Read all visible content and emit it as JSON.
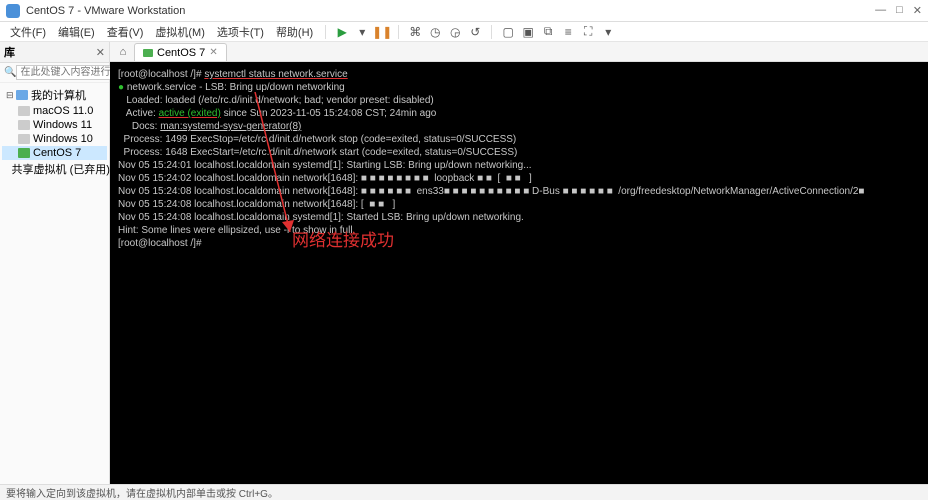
{
  "window": {
    "title": "CentOS 7 - VMware Workstation"
  },
  "menus": [
    "文件(F)",
    "编辑(E)",
    "查看(V)",
    "虚拟机(M)",
    "选项卡(T)",
    "帮助(H)"
  ],
  "sidebar": {
    "title": "库",
    "search_placeholder": "在此处键入内容进行搜索",
    "root": "我的计算机",
    "items": [
      {
        "label": "macOS 11.0",
        "on": false
      },
      {
        "label": "Windows 11",
        "on": false
      },
      {
        "label": "Windows 10",
        "on": false
      },
      {
        "label": "CentOS 7",
        "on": true,
        "selected": true
      }
    ],
    "shared": "共享虚拟机 (已弃用)"
  },
  "tab": {
    "label": "CentOS 7"
  },
  "terminal": {
    "prompt1": "[root@localhost /]# ",
    "cmd": "systemctl status network.service",
    "l2_a": "● ",
    "l2_b": "network.service - LSB: Bring up/down networking",
    "l3": "   Loaded: loaded (/etc/rc.d/init.d/network; bad; vendor preset: disabled)",
    "l4_a": "   Active: ",
    "l4_b": "active (exited)",
    "l4_c": " since Sun 2023-11-05 15:24:08 CST; 24min ago",
    "l5_a": "     Docs: ",
    "l5_b": "man:systemd-sysv-generator(8)",
    "l6": "  Process: 1499 ExecStop=/etc/rc.d/init.d/network stop (code=exited, status=0/SUCCESS)",
    "l7": "  Process: 1648 ExecStart=/etc/rc.d/init.d/network start (code=exited, status=0/SUCCESS)",
    "l8": "",
    "l9": "Nov 05 15:24:01 localhost.localdomain systemd[1]: Starting LSB: Bring up/down networking...",
    "l10": "Nov 05 15:24:02 localhost.localdomain network[1648]: ■ ■ ■ ■ ■ ■ ■ ■  loopback ■ ■  [  ■ ■   ]",
    "l11": "Nov 05 15:24:08 localhost.localdomain network[1648]: ■ ■ ■ ■ ■ ■  ens33■ ■ ■ ■ ■ ■ ■ ■ ■ ■ D-Bus ■ ■ ■ ■ ■ ■  /org/freedesktop/NetworkManager/ActiveConnection/2■",
    "l12": "Nov 05 15:24:08 localhost.localdomain network[1648]: [  ■ ■   ]",
    "l13": "Nov 05 15:24:08 localhost.localdomain systemd[1]: Started LSB: Bring up/down networking.",
    "l14": "Hint: Some lines were ellipsized, use -l to show in full.",
    "prompt2": "[root@localhost /]# "
  },
  "annotation": {
    "text": "网络连接成功"
  },
  "status": {
    "text": "要将输入定向到该虚拟机，请在虚拟机内部单击或按 Ctrl+G。"
  }
}
